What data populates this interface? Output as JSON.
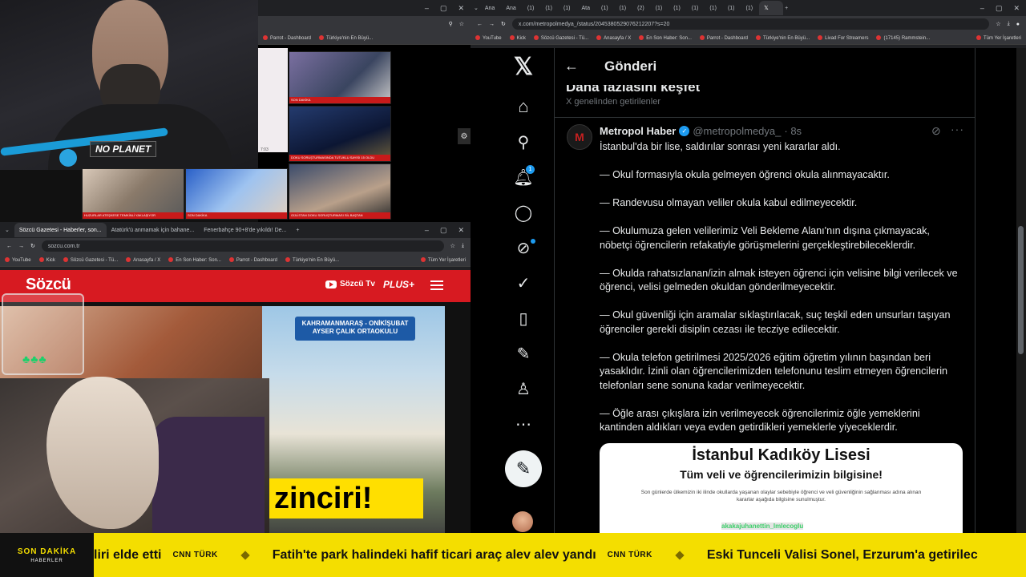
{
  "webcam": {
    "sign": "NO PLANET"
  },
  "news_window": {
    "left_label": "7:03",
    "thumbs": [
      {
        "caption": "SON DAKİKA"
      },
      {
        "caption": "DOKU SORUŞTURMASINDA TUTUKLU SAYISI 15 OLDU"
      },
      {
        "caption": "HUZURLAR ATEŞKESE TEMKİNLİ YAKLAŞIYOR"
      },
      {
        "caption": "SON DAKİKA"
      },
      {
        "caption": "GÜLİSTAN DOKU SORUŞTURMASI SİL BAŞTAN"
      }
    ]
  },
  "sozcu_window": {
    "tabs": [
      "Sözcü Gazetesi - Haberler, son...",
      "Atatürk'ü anmamak için bahane...",
      "Fenerbahçe 90+8'de yıkıldı! De..."
    ],
    "url": "sozcu.com.tr",
    "bookmarks": [
      "YouTube",
      "Kick",
      "Sözcü Gazetesi - Tü...",
      "Anasayfa / X",
      "En Son Haber: Son...",
      "Parrot - Dashboard",
      "Türkiye'nin En Büyü..."
    ],
    "bookmarks_all": "Tüm Yer İşaretleri",
    "logo": "Sözcü",
    "tv_label": "Sözcü Tv",
    "plus_label": "PLUS+",
    "school_sign": "KAHRAMANMARAŞ - ONİKİŞUBAT\nAYSER ÇALIK ORTAOKULU",
    "headline_fragment": "zinciri!"
  },
  "x_window": {
    "tabs": [
      "Ana",
      "Ana",
      "(1)",
      "(1)",
      "(1)",
      "Ata",
      "(1)",
      "(1)",
      "(2)",
      "(1)",
      "(1)",
      "(1)",
      "(1)",
      "(1)",
      "(1)",
      ""
    ],
    "url": "x.com/metropolmedya_/status/2045380529076212207?s=20",
    "bookmarks": [
      "YouTube",
      "Kick",
      "Sözcü Gazetesi - Tü...",
      "Anasayfa / X",
      "En Son Haber: Son...",
      "Parrot - Dashboard",
      "Türkiye'nin En Büyü...",
      "Livad For Streamers",
      "(17145) Rammstein..."
    ],
    "bookmarks_all": "Tüm Yer İşaretleri",
    "header_title": "Gönderi",
    "discover_title": "Daha fazlasını keşfet",
    "discover_sub": "X genelinden getirilenler",
    "notification_count": "1",
    "post": {
      "avatar_letter": "M",
      "name": "Metropol Haber",
      "handle": "@metropolmedya_",
      "time": "· 8s",
      "paragraphs": [
        "İstanbul'da bir lise, saldırılar sonrası yeni kararlar aldı.",
        "— Okul formasıyla okula gelmeyen öğrenci okula alınmayacaktır.",
        "— Randevusu olmayan veliler okula kabul edilmeyecektir.",
        "— Okulumuza gelen velilerimiz Veli Bekleme Alanı'nın dışına çıkmayacak, nöbetçi öğrencilerin refakatiyle görüşmelerini gerçekleştirebileceklerdir.",
        "— Okulda rahatsızlanan/izin almak isteyen öğrenci için velisine bilgi verilecek ve öğrenci, velisi gelmeden okuldan gönderilmeyecektir.",
        "— Okul güvenliği için aramalar sıklaştırılacak, suç teşkil eden unsurları taşıyan öğrenciler gerekli disiplin cezası ile tecziye edilecektir.",
        "— Okula telefon getirilmesi 2025/2026 eğitim öğretim yılının başından beri yasaklıdır. İzinli olan öğrencilerimizden telefonunu teslim etmeyen öğrencilerin telefonları sene sonuna kadar verilmeyecektir.",
        "— Öğle arası çıkışlara izin verilmeyecek öğrencilerimiz öğle yemeklerini kantinden aldıkları veya evden getirdikleri yemeklerle yiyeceklerdir."
      ],
      "image": {
        "title": "İstanbul Kadıköy Lisesi",
        "subtitle": "Tüm veli ve öğrencilerimizin bilgisine!",
        "small_text": "Son günlerde ülkemizin iki ilinde okullarda yaşanan olaylar sebebiyle öğrenci ve veli güvenliğinin sağlanması adına alınan kararlar aşağıda bilgisine sunulmuştur."
      }
    },
    "chat_overlay": "akakajuhanettin_lmlecoglu"
  },
  "ticker": {
    "breaking_label": "SON DAKİKA",
    "breaking_sub": "HABERLER",
    "items": [
      {
        "text": "liri elde etti",
        "source": "CNN TÜRK"
      },
      {
        "text": "Fatih'te park halindeki hafif ticari araç alev alev yandı",
        "source": "CNN TÜRK"
      },
      {
        "text": "Eski Tunceli Valisi Sonel, Erzurum'a getirilec",
        "source": ""
      }
    ]
  },
  "colors": {
    "x_blue": "#1d9bf0",
    "sozcu_red": "#d71a21",
    "ticker_yellow": "#f4de00"
  }
}
